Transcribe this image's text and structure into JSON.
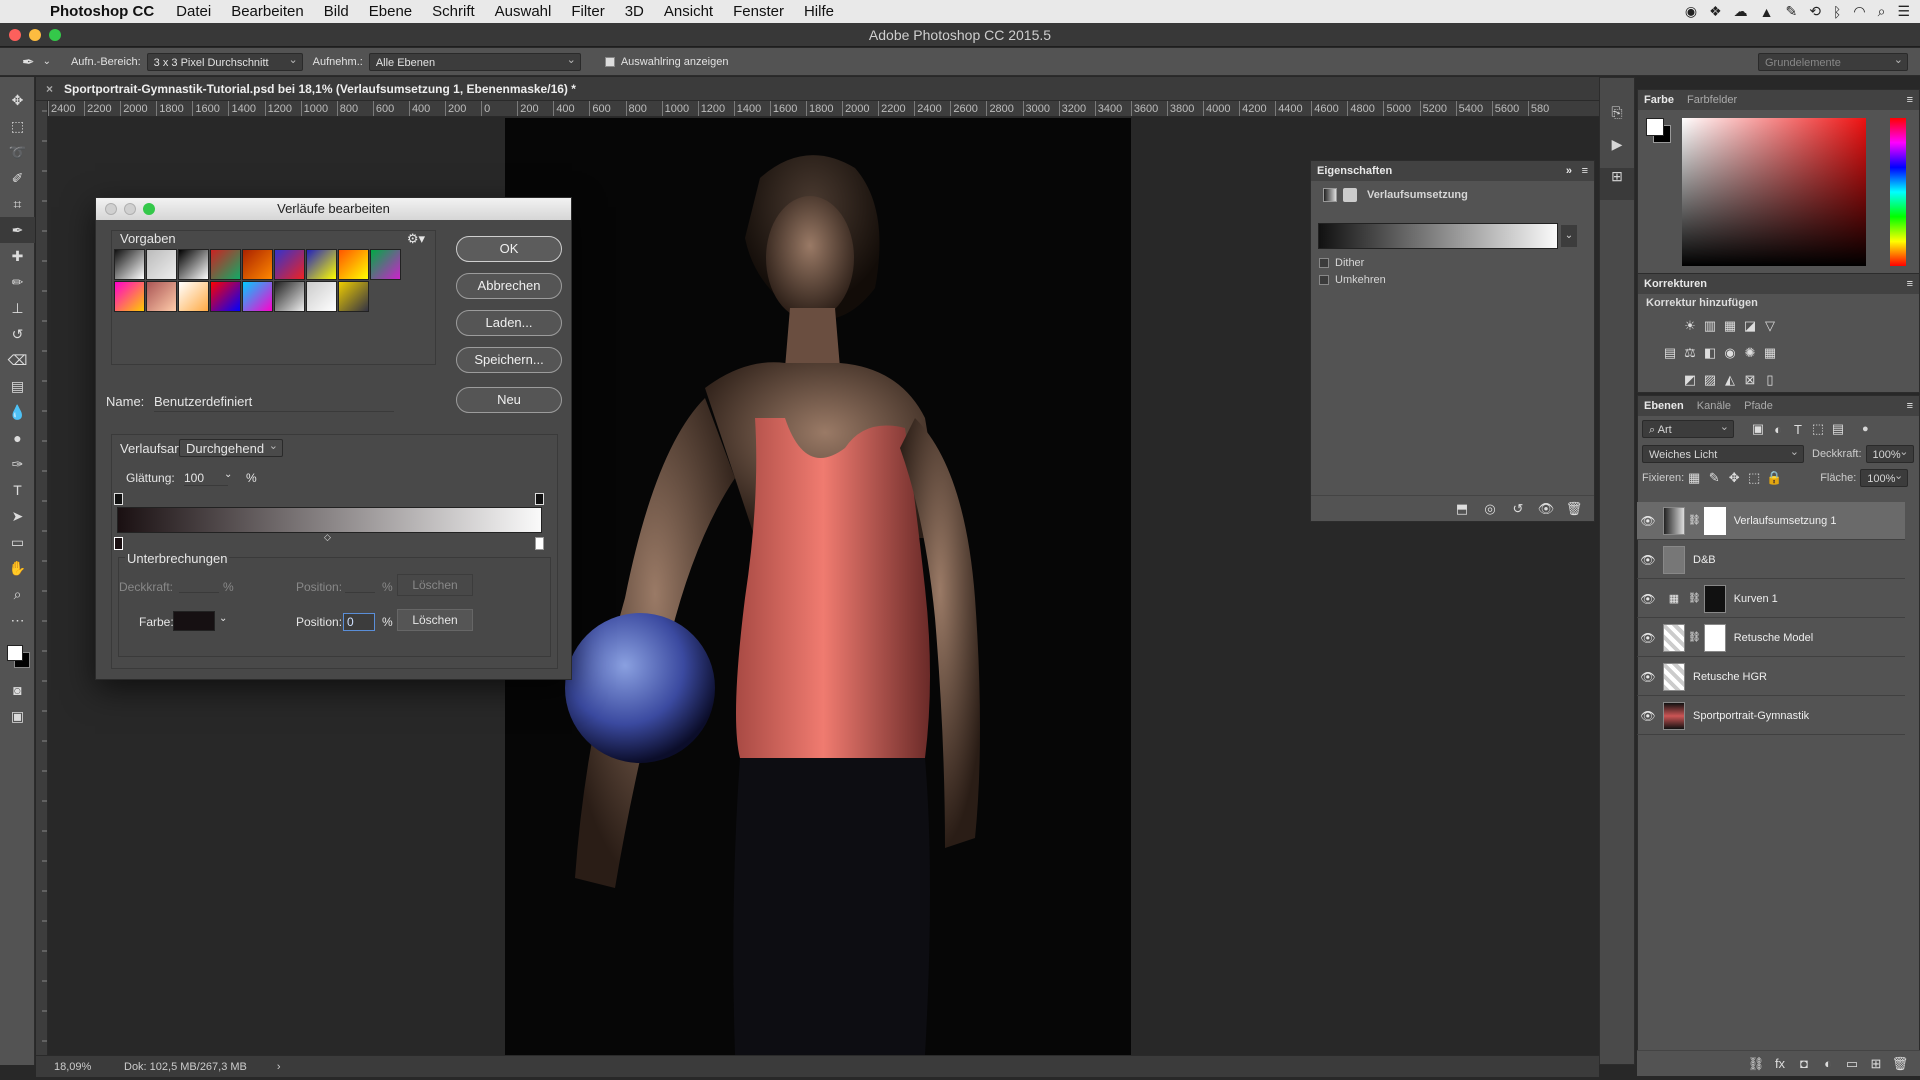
{
  "menubar": {
    "app_name": "Photoshop CC",
    "items": [
      "Datei",
      "Bearbeiten",
      "Bild",
      "Ebene",
      "Schrift",
      "Auswahl",
      "Filter",
      "3D",
      "Ansicht",
      "Fenster",
      "Hilfe"
    ]
  },
  "window": {
    "title": "Adobe Photoshop CC 2015.5"
  },
  "options_bar": {
    "sample_size_label": "Aufn.-Bereich:",
    "sample_size_value": "3 x 3 Pixel Durchschnitt",
    "sample_label": "Aufnehm.:",
    "sample_value": "Alle Ebenen",
    "show_ring_label": "Auswahlring anzeigen",
    "workspace": "Grundelemente"
  },
  "document": {
    "tab_title": "Sportportrait-Gymnastik-Tutorial.psd bei 18,1% (Verlaufsumsetzung 1, Ebenenmaske/16) *",
    "ruler_ticks": [
      "2400",
      "2200",
      "2000",
      "1800",
      "1600",
      "1400",
      "1200",
      "1000",
      "800",
      "600",
      "400",
      "200",
      "0",
      "200",
      "400",
      "600",
      "800",
      "1000",
      "1200",
      "1400",
      "1600",
      "1800",
      "2000",
      "2200",
      "2400",
      "2600",
      "2800",
      "3000",
      "3200",
      "3400",
      "3600",
      "3800",
      "4000",
      "4200",
      "4400",
      "4600",
      "4800",
      "5000",
      "5200",
      "5400",
      "5600",
      "580"
    ]
  },
  "status_bar": {
    "zoom": "18,09%",
    "doc_info": "Dok: 102,5 MB/267,3 MB"
  },
  "gradient_dialog": {
    "title": "Verläufe bearbeiten",
    "presets_label": "Vorgaben",
    "ok": "OK",
    "cancel": "Abbrechen",
    "load": "Laden...",
    "save": "Speichern...",
    "new": "Neu",
    "name_label": "Name:",
    "name_value": "Benutzerdefiniert",
    "type_label": "Verlaufsart:",
    "type_value": "Durchgehend",
    "smoothness_label": "Glättung:",
    "smoothness_value": "100",
    "percent": "%",
    "stops_label": "Unterbrechungen",
    "opacity_label": "Deckkraft:",
    "position_label": "Position:",
    "delete_label": "Löschen",
    "color_label": "Farbe:",
    "color_position_value": "0",
    "preset_colors": [
      [
        "#111",
        "#fff"
      ],
      [
        "#bbb",
        "#eee"
      ],
      [
        "#000",
        "#fff"
      ],
      [
        "#c22",
        "#1a6"
      ],
      [
        "#a20",
        "#f80"
      ],
      [
        "#33c",
        "#e22"
      ],
      [
        "#22b",
        "#ff0"
      ],
      [
        "#f50",
        "#ff0"
      ],
      [
        "#0a4",
        "#c2c"
      ],
      [
        "#f0c",
        "#fc0"
      ],
      [
        "#a55",
        "#fca"
      ],
      [
        "#fff",
        "#fa4"
      ],
      [
        "#f00",
        "#00f"
      ],
      [
        "#0cf",
        "#f0c"
      ],
      [
        "#222",
        "#eee"
      ],
      [
        "#ccc",
        "#fff"
      ],
      [
        "#ec0",
        "#334"
      ]
    ]
  },
  "properties_panel": {
    "title": "Eigenschaften",
    "subtitle": "Verlaufsumsetzung",
    "dither": "Dither",
    "reverse": "Umkehren"
  },
  "color_panel": {
    "tab_color": "Farbe",
    "tab_swatches": "Farbfelder"
  },
  "adjustments_panel": {
    "title": "Korrekturen",
    "subtitle": "Korrektur hinzufügen"
  },
  "layers_panel": {
    "tab_layers": "Ebenen",
    "tab_channels": "Kanäle",
    "tab_paths": "Pfade",
    "filter_kind": "Art",
    "blend_mode": "Weiches Licht",
    "opacity_label": "Deckkraft:",
    "opacity_value": "100%",
    "lock_label": "Fixieren:",
    "fill_label": "Fläche:",
    "fill_value": "100%",
    "layers": [
      {
        "name": "Verlaufsumsetzung 1"
      },
      {
        "name": "D&B"
      },
      {
        "name": "Kurven 1"
      },
      {
        "name": "Retusche Model"
      },
      {
        "name": "Retusche HGR"
      },
      {
        "name": "Sportportrait-Gymnastik"
      }
    ]
  }
}
